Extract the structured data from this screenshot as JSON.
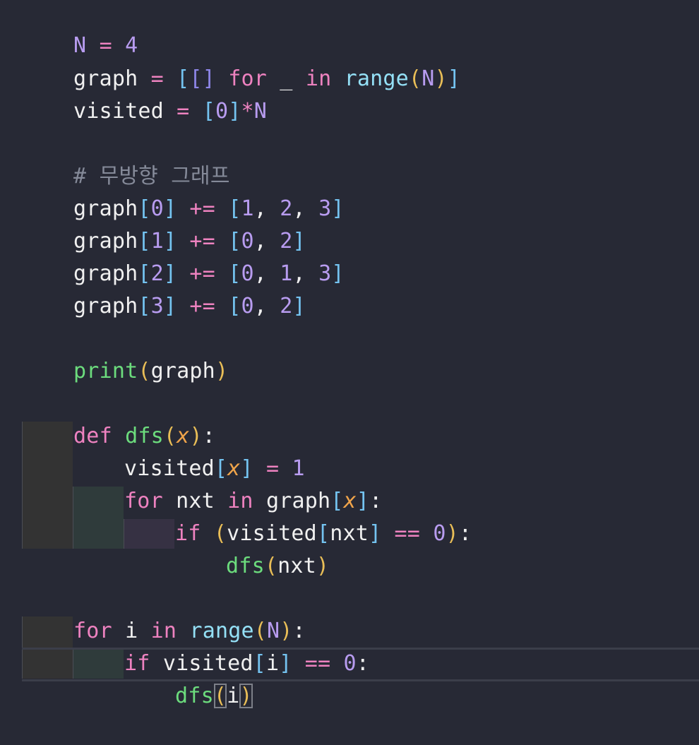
{
  "editor": {
    "language": "python",
    "colors": {
      "background": "#272935",
      "keyword": "#EE82C0",
      "number": "#B89CF0",
      "bracket": "#74C3F0",
      "paren": "#E9BE57",
      "function": "#6CDC7D",
      "builtin": "#94E0F6",
      "comment": "#858A99",
      "text": "#F0F0F0"
    },
    "code": {
      "line_01": [
        "N",
        " = ",
        "4"
      ],
      "line_02": [
        "graph",
        " = ",
        "[",
        "[]",
        " ",
        "for",
        " _ ",
        "in",
        " ",
        "range",
        "(",
        "N",
        ")",
        "]"
      ],
      "line_03": [
        "visited",
        " = ",
        "[",
        "0",
        "]",
        "*",
        "N"
      ],
      "line_05": [
        "# 무방향 그래프"
      ],
      "line_06": [
        "graph",
        "[",
        "0",
        "]",
        " ",
        "+=",
        " ",
        "[",
        "1",
        ", ",
        "2",
        ", ",
        "3",
        "]"
      ],
      "line_07": [
        "graph",
        "[",
        "1",
        "]",
        " ",
        "+=",
        " ",
        "[",
        "0",
        ", ",
        "2",
        "]"
      ],
      "line_08": [
        "graph",
        "[",
        "2",
        "]",
        " ",
        "+=",
        " ",
        "[",
        "0",
        ", ",
        "1",
        ", ",
        "3",
        "]"
      ],
      "line_09": [
        "graph",
        "[",
        "3",
        "]",
        " ",
        "+=",
        " ",
        "[",
        "0",
        ", ",
        "2",
        "]"
      ],
      "line_11": [
        "print",
        "(",
        "graph",
        ")"
      ],
      "line_13": [
        "def",
        " ",
        "dfs",
        "(",
        "x",
        ")",
        ":"
      ],
      "line_14": [
        "visited",
        "[",
        "x",
        "]",
        " ",
        "=",
        " ",
        "1"
      ],
      "line_15": [
        "for",
        " nxt ",
        "in",
        " graph",
        "[",
        "x",
        "]",
        ":"
      ],
      "line_16": [
        "if",
        " ",
        "(",
        "visited",
        "[",
        "nxt",
        "]",
        " ",
        "==",
        " ",
        "0",
        ")",
        ":"
      ],
      "line_17": [
        "dfs",
        "(",
        "nxt",
        ")"
      ],
      "line_19": [
        "for",
        " i ",
        "in",
        " ",
        "range",
        "(",
        "N",
        ")",
        ":"
      ],
      "line_20": [
        "if",
        " visited",
        "[",
        "i",
        "]",
        " ",
        "==",
        " ",
        "0",
        ":"
      ],
      "line_21": [
        "dfs",
        "(",
        "i",
        ")"
      ]
    }
  }
}
